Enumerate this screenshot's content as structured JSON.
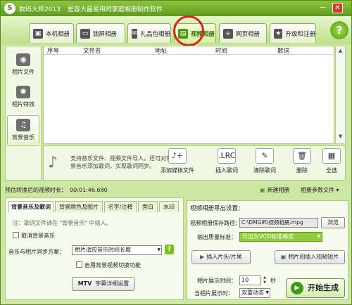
{
  "window": {
    "app_title": "数码大师2013",
    "subtitle": "是容大最易用的家庭相册制作软件",
    "minimize_glyph": "—",
    "close_glyph": "✕"
  },
  "tabs": [
    {
      "label": "本机相册",
      "icon": "monitor-icon",
      "glyph": "▣"
    },
    {
      "label": "锁屏相册",
      "icon": "tv-icon",
      "glyph": "▭"
    },
    {
      "label": "礼品包相册",
      "icon": "gift-icon",
      "glyph": "✉"
    },
    {
      "label": "视频相册",
      "icon": "film-icon",
      "glyph": "▤"
    },
    {
      "label": "网页相册",
      "icon": "ie-icon",
      "glyph": "e"
    },
    {
      "label": "升级和注册",
      "icon": "upgrade-icon",
      "glyph": "★"
    }
  ],
  "help_glyph": "?",
  "leftnav": [
    {
      "label": "相片文件",
      "icon": "camera-icon",
      "glyph": "◉"
    },
    {
      "label": "相片特效",
      "icon": "sparkle-icon",
      "glyph": "✺"
    },
    {
      "label": "背景音乐",
      "icon": "music-icon",
      "glyph": "♫"
    }
  ],
  "list": {
    "columns": [
      "序号",
      "文件名",
      "地址",
      "时间",
      "歌词"
    ],
    "scroll_up": "▲",
    "scroll_down": "▼"
  },
  "actions": {
    "note_glyph": "♪",
    "info": "支持音乐文件、视频文件导入。还可对背景音乐添加歌词，实现歌词同步。",
    "buttons": [
      {
        "label": "添加媒体文件",
        "icon": "add-media-icon",
        "glyph": "♪+"
      },
      {
        "label": "插入歌词",
        "icon": "lrc-icon",
        "glyph": ".LRC"
      },
      {
        "label": "清除歌词",
        "icon": "clear-lyrics-icon",
        "glyph": "✎"
      },
      {
        "label": "删除",
        "icon": "trash-icon",
        "glyph": "🗑"
      },
      {
        "label": "全选",
        "icon": "select-all-icon",
        "glyph": "▦"
      }
    ]
  },
  "status": {
    "label": "预估转换后的视频时长：",
    "value": "00:01:46.680",
    "new_folder": "新建相册",
    "param_settings": "相册参数文件 ▾"
  },
  "bottom_tabs": [
    "背景音乐及歌词",
    "背景颜色及图片",
    "名字/注释",
    "旁白",
    "水印"
  ],
  "music": {
    "hint": "注：歌词文件请在 \"背景音乐\" 中插入。",
    "cancel_label": "取消背景音乐",
    "sync_label": "音乐与相片同步方案：",
    "sync_value": "相片适应音乐时间长度",
    "help_glyph": "?",
    "switch_label": "启用背景视频切换功能",
    "mtv_prefix": "MTV",
    "mtv_label": "字幕详细设置"
  },
  "export": {
    "title": "视频相册导出设置：",
    "path_label": "视频相册保存路径：",
    "path_value": "C:\\DMGift\\视频相册.mpg",
    "browse": "浏览",
    "quality_label": "输出质量标准：",
    "quality_value": "导出为VCD标准格式",
    "insert_clip": "插入片头/片尾",
    "insert_video": "相片间插入视频短片",
    "show_time_label": "相片展示时间：",
    "show_time_value": "10",
    "seconds": "秒",
    "mode_label": "当相片展示时：",
    "mode_value": "双重动态",
    "start": "开始生成",
    "start_glyph": "▶"
  },
  "colors": {
    "accent": "#5e9a1e",
    "highlight_ring": "#e02020",
    "quality_select": "#8fce3a"
  }
}
